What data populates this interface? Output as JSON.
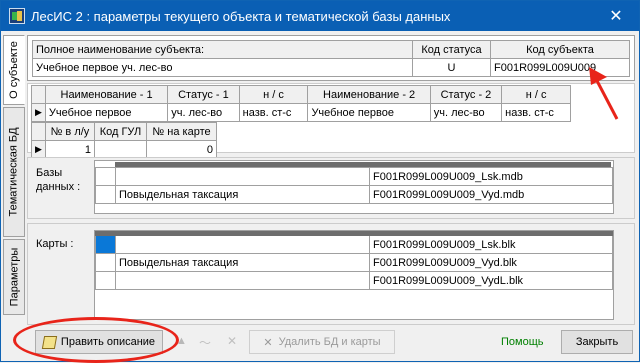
{
  "window": {
    "title": "ЛесИС 2 : параметры текущего объекта и тематической базы данных",
    "close": "✕"
  },
  "tabs": [
    "О субъекте",
    "Тематическая БД",
    "Параметры"
  ],
  "subject": {
    "name_header": "Полное наименование субъекта:",
    "status_header": "Код статуса",
    "code_header": "Код субъекта",
    "name_value": "Учебное первое уч. лес-во",
    "status_value": "U",
    "code_value": "F001R099L009U009"
  },
  "hierarchy": {
    "headers": [
      "Наименование - 1",
      "Статус - 1",
      "н / с",
      "Наименование - 2",
      "Статус - 2",
      "н / с"
    ],
    "row": [
      "Учебное первое",
      "уч. лес-во",
      "назв. ст-с",
      "Учебное первое",
      "уч. лес-во",
      "назв. ст-с"
    ]
  },
  "numbers": {
    "headers": [
      "№ в л/у",
      "Код ГУЛ",
      "№ на карте"
    ],
    "row": [
      "1",
      "",
      "0"
    ]
  },
  "databases": {
    "label": "Базы данных :",
    "rows": [
      {
        "desc": "",
        "file": "F001R099L009U009_Lsk.mdb"
      },
      {
        "desc": "Повыдельная таксация",
        "file": "F001R099L009U009_Vyd.mdb"
      }
    ]
  },
  "maps": {
    "label": "Карты :",
    "rows": [
      {
        "desc": "",
        "file": "F001R099L009U009_Lsk.blk"
      },
      {
        "desc": "Повыдельная таксация",
        "file": "F001R099L009U009_Vyd.blk"
      },
      {
        "desc": "",
        "file": "F001R099L009U009_VydL.blk"
      }
    ]
  },
  "toolbar": {
    "edit_label": "Править описание",
    "delete_label": "Удалить БД и карты",
    "help_label": "Помощь",
    "close_label": "Закрыть"
  },
  "colors": {
    "titlebar": "#0a5fb4",
    "selection": "#0a78d7",
    "annotation": "#e8241a",
    "help": "#008000"
  }
}
